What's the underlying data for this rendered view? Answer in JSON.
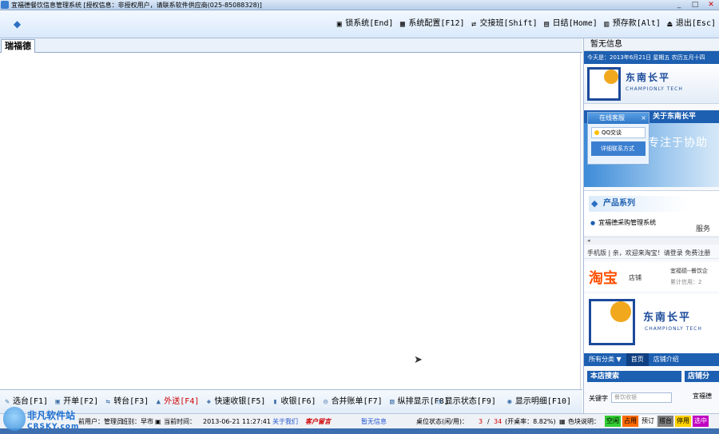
{
  "window": {
    "title": "宜福德餐饮信息管理系统 [授权信息：非授权用户，请联系软件供应商(025-85088328)]",
    "minimize": "_",
    "maximize": "□",
    "close": "✕"
  },
  "toolbar": {
    "home_icon": "◆",
    "items": [
      {
        "label": "锁系统[End]",
        "icon": "lock-icon",
        "glyph": "▣"
      },
      {
        "label": "系统配置[F12]",
        "icon": "settings-icon",
        "glyph": "▦"
      },
      {
        "label": "交接班[Shift]",
        "icon": "handover-icon",
        "glyph": "⇄"
      },
      {
        "label": "日结[Home]",
        "icon": "daily-close-icon",
        "glyph": "▤"
      },
      {
        "label": "预存款[Alt]",
        "icon": "deposit-icon",
        "glyph": "▥"
      },
      {
        "label": "退出[Esc]",
        "icon": "exit-icon",
        "glyph": "⏏"
      }
    ]
  },
  "main": {
    "tab_label": "瑞福德"
  },
  "side": {
    "header": "暂无信息",
    "date_line": "今天是：2013年6月21日 星期五 农历五月十四",
    "logo_text": "东南长平",
    "logo_sub": "CHAMPIONLY TECH",
    "about_label": "关于东南长平",
    "online_title": "在线客服",
    "online_close": "×",
    "qq_label": "QQ交谈",
    "contact_label": "详细联系方式",
    "slogan": "专注于协助",
    "product_title": "产品系列",
    "product_item": "宜福德采购管理系统",
    "serve_label": "服务",
    "hscroll_left": "◂",
    "tb_row": "手机版 | 亲，欢迎来淘宝！请登录 免费注册",
    "taobao_logo": "淘宝",
    "taobao_small": "店铺",
    "shop_name": "宜福德--餐饮企",
    "credit_label": "累计信用：2",
    "logo_text2": "东南长平",
    "logo_sub2": "CHAMPIONLY TECH",
    "nav": [
      "所有分类 ▼",
      "首页",
      "店铺介绍"
    ],
    "store_search": "本店搜索",
    "store_cat": "店铺分",
    "keyword_label": "关键字",
    "keyword_placeholder": "餐饮收银",
    "shop_name2": "宜福德"
  },
  "actions": {
    "left": [
      {
        "label": "选台[F1]",
        "glyph": "✎"
      },
      {
        "label": "开单[F2]",
        "glyph": "▣"
      },
      {
        "label": "转台[F3]",
        "glyph": "⇆"
      },
      {
        "label": "外送[F4]",
        "glyph": "▲",
        "red": true
      },
      {
        "label": "快速收银[F5]",
        "glyph": "◈"
      },
      {
        "label": "收银[F6]",
        "glyph": "▮"
      },
      {
        "label": "合并账单[F7]",
        "glyph": "◎"
      },
      {
        "label": "纵排显示[F8]",
        "glyph": "▧"
      }
    ],
    "right": [
      {
        "label": "显示状态[F9]",
        "glyph": "◔"
      },
      {
        "label": "显示明细[F10]",
        "glyph": "◉"
      }
    ]
  },
  "status": {
    "user": "前用户：管理员",
    "shift": "班别：早市",
    "time_label": "当前时间：",
    "time_value": "2013-06-21 11:27:41",
    "about_link": "关于我们",
    "feedback": "客户留言",
    "info": "暂无信息",
    "table_state_label": "桌位状态(闲/用)：",
    "table_used": "3",
    "table_sep": "/",
    "table_total": "34",
    "open_rate": "(开桌率：8.82%)",
    "legend_label": "色块说明：",
    "legend": [
      {
        "label": "空闲",
        "bg": "#33cc33",
        "fg": "#000000"
      },
      {
        "label": "占用",
        "bg": "#ff6a00",
        "fg": "#000000"
      },
      {
        "label": "预订",
        "bg": "#ffffff",
        "fg": "#000000"
      },
      {
        "label": "搭台",
        "bg": "#808080",
        "fg": "#000000"
      },
      {
        "label": "停用",
        "bg": "#ffd200",
        "fg": "#000000"
      },
      {
        "label": "选中",
        "bg": "#c000c0",
        "fg": "#ffffff"
      }
    ]
  },
  "watermark": {
    "line1": "非凡软件站",
    "line2": "CRSKY.com"
  },
  "colors": {
    "accent": "#1d5fb1",
    "red": "#d00000"
  }
}
